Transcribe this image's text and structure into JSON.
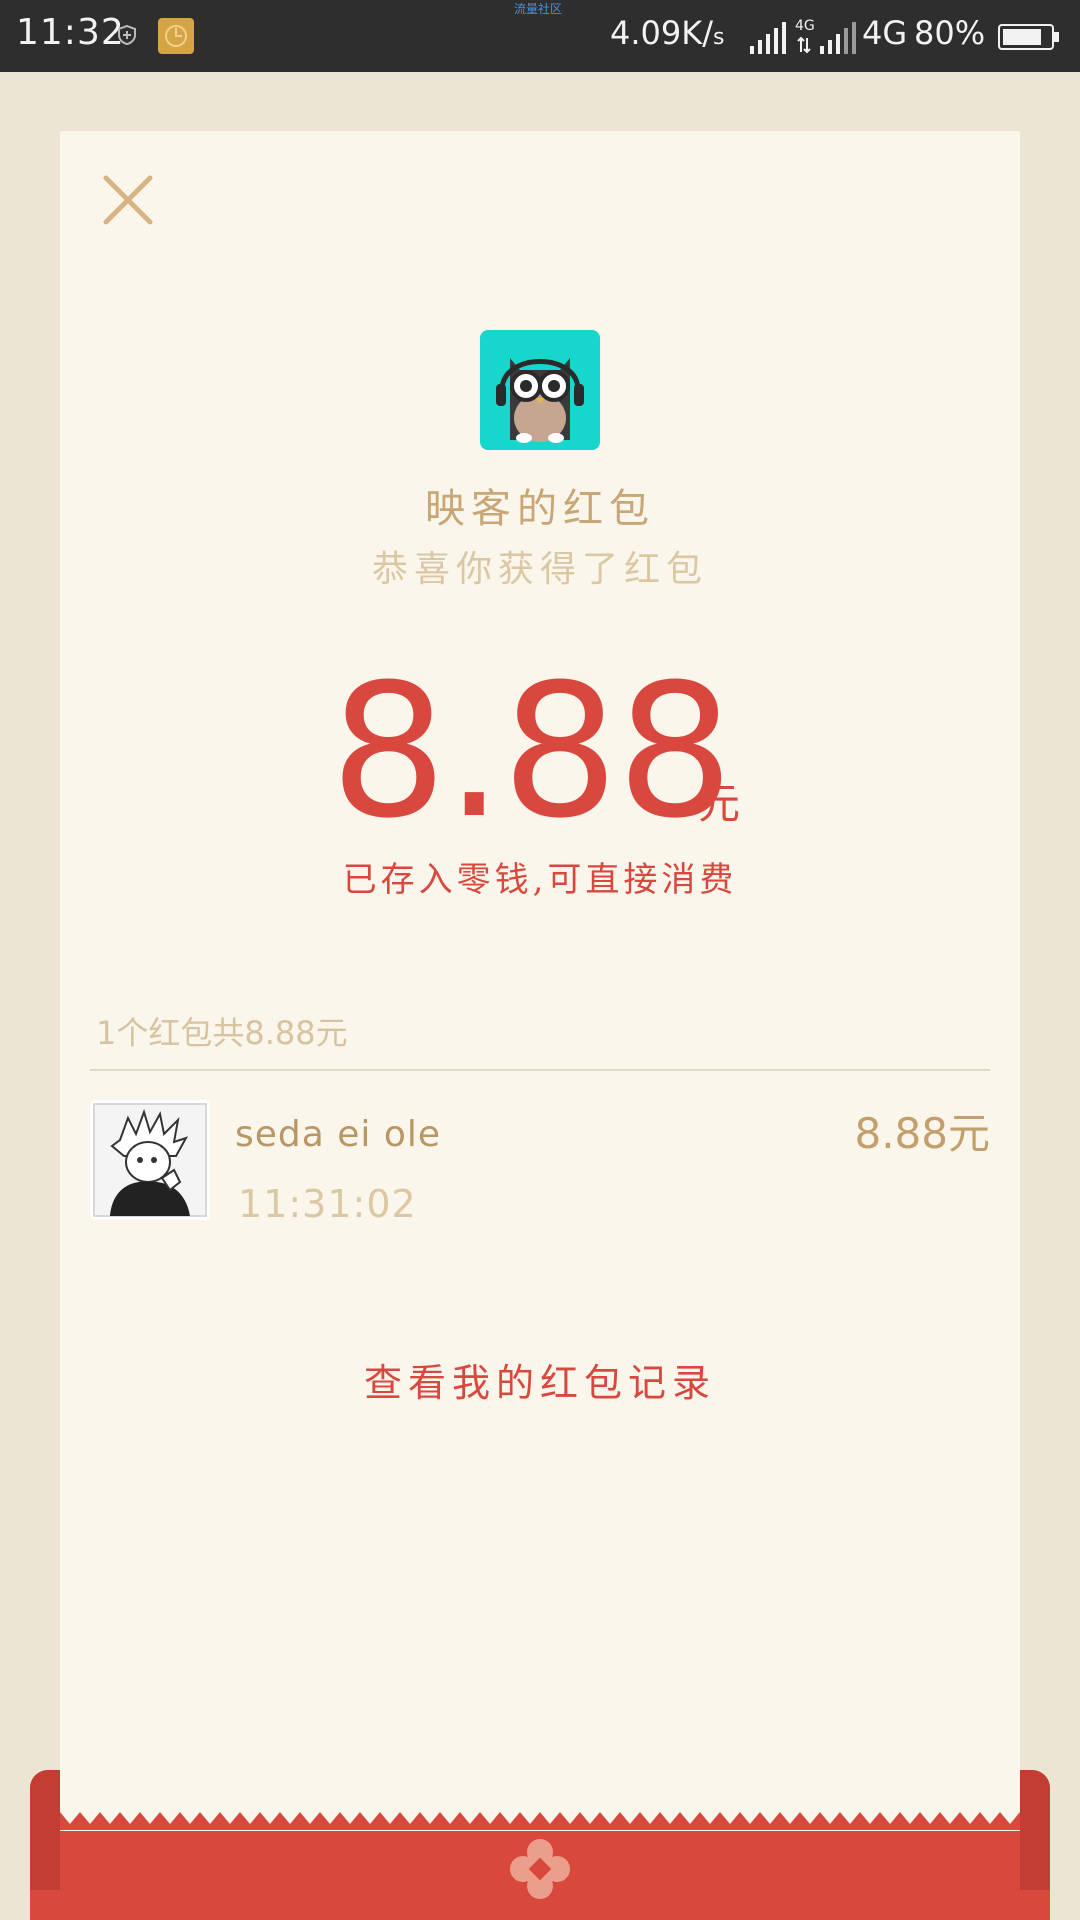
{
  "status_bar": {
    "time": "11:32",
    "watermark": "流量社区",
    "speed_value": "4.09K/",
    "speed_unit": "s",
    "network_small": "4G",
    "network": "4G",
    "battery": "80%"
  },
  "envelope": {
    "sender_title": "映客的红包",
    "subtitle": "恭喜你获得了红包",
    "amount": "8.88",
    "amount_unit": "元",
    "note": "已存入零钱,可直接消费",
    "summary": "1个红包共8.88元",
    "claims": [
      {
        "name": "seda ei ole",
        "time": "11:31:02",
        "amount": "8.88元"
      }
    ],
    "history_link": "查看我的红包记录"
  },
  "colors": {
    "accent_red": "#d8483e",
    "gold": "#c8a675",
    "card_bg": "#faf6ec",
    "page_bg": "#ede5d4",
    "logo_teal": "#17d6cc"
  },
  "icons": {
    "close": "close-icon",
    "logo": "owl-logo-icon",
    "flower": "flower-icon"
  }
}
